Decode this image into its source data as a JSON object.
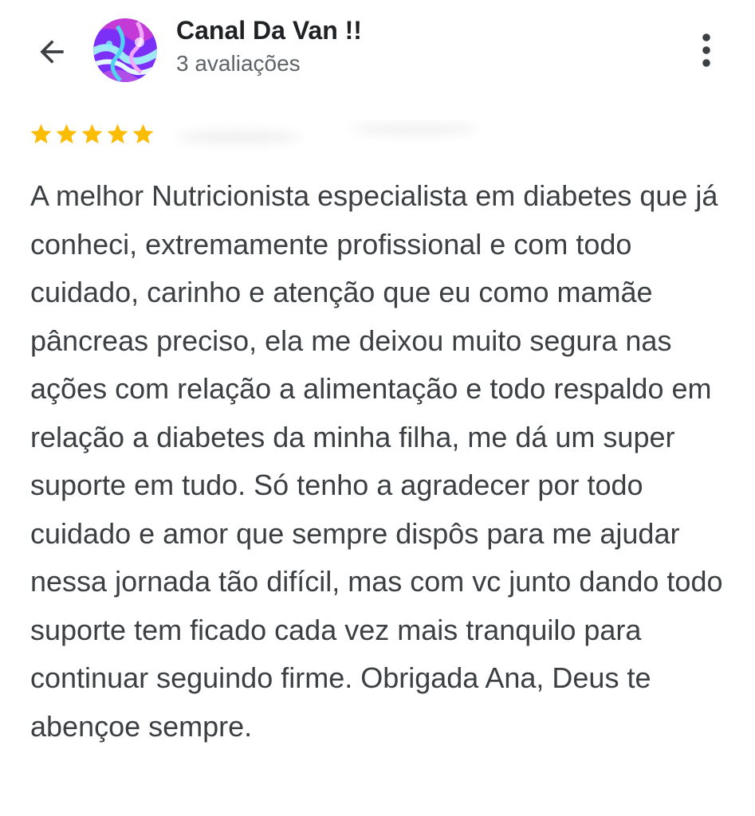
{
  "header": {
    "back_icon": "arrow-back-icon",
    "reviewer_name": "Canal Da Van !!",
    "review_count": "3 avaliações",
    "more_icon": "more-vert-icon"
  },
  "review": {
    "rating": 5,
    "rating_max": 5,
    "star_color": "#fbbc04",
    "text": "A melhor Nutricionista especialista em diabetes que já conheci, extremamente profissional e com todo cuidado, carinho e atenção que eu como mamãe pâncreas preciso, ela me deixou muito segura nas ações com relação a alimentação e todo respaldo em relação a diabetes da minha filha, me dá um super suporte em tudo. Só tenho a agradecer por todo cuidado e amor que sempre dispôs para me ajudar nessa jornada tão difícil, mas com vc junto dando todo suporte tem ficado cada vez mais tranquilo para continuar seguindo firme. Obrigada Ana, Deus te abençoe sempre."
  }
}
